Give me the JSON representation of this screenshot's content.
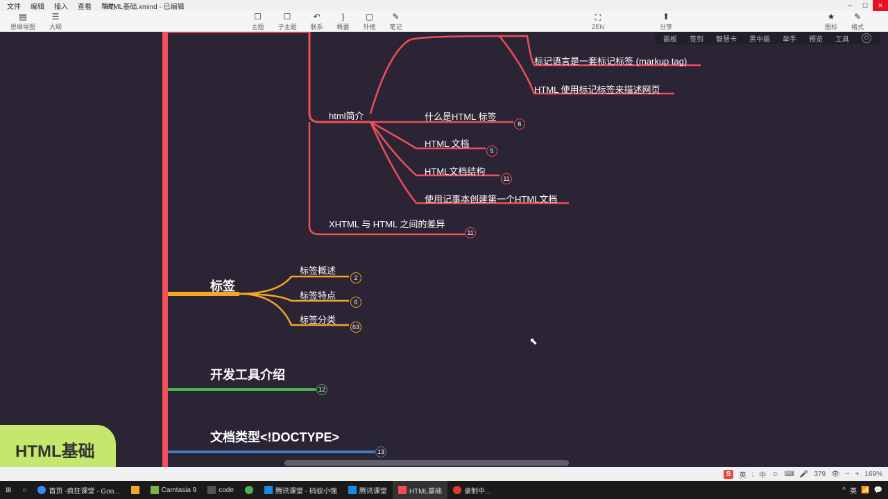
{
  "menu": {
    "file": "文件",
    "edit": "编辑",
    "insert": "插入",
    "view": "查看",
    "help": "帮助"
  },
  "title": "HTML基础.xmind - 已编辑",
  "toolbar": {
    "mindmap": "思维导图",
    "outline": "大纲",
    "theme": "主题",
    "layout": "子主题",
    "relation": "联系",
    "summary": "概要",
    "boundary": "外框",
    "notes": "笔记",
    "zen": "ZEN",
    "share": "分享",
    "iconlib": "图标",
    "format": "格式"
  },
  "darktabs": {
    "canvas": "画板",
    "sign": "签到",
    "smartcard": "智慧卡",
    "blackboard": "黑中画",
    "raise": "举手",
    "preview": "预览",
    "tools": "工具"
  },
  "root": "HTML基础",
  "nodes": {
    "branch1": "html简介",
    "b1c2": "什么是HTML 标签",
    "b1c3": "HTML 文档",
    "b1c4": "HTML文档结构",
    "b1c5": "使用记事本创建第一个HTML文档",
    "b1s1": "标记语言是一套标记标签 (markup tag)",
    "b1s2": "HTML 使用标记标签来描述网页",
    "branch1b": "XHTML 与 HTML 之间的差异",
    "branch2": "标签",
    "b2c1": "标签概述",
    "b2c2": "标签特点",
    "b2c3": "标签分类",
    "branch3": "开发工具介绍",
    "branch4": "文档类型<!DOCTYPE>"
  },
  "badges": {
    "b1c2": "6",
    "b1c3": "5",
    "b1c4": "11",
    "branch1b": "11",
    "b2c1": "2",
    "b2c2": "6",
    "b2c3": "63",
    "branch3": "12",
    "branch4": "13"
  },
  "status": {
    "ime": "S",
    "lang": "英",
    "punct": "中",
    "emoji": "☺",
    "count": "379",
    "sep": ";",
    "zoom": "169%"
  },
  "taskbar": {
    "t1": "首页 -疯狂课堂 - Goo...",
    "t2": "Camtasia 9",
    "t3": "code",
    "t4": "腾讯课堂 - 码蚁小强",
    "t5": "腾讯课堂",
    "t6": "HTML基础",
    "t7": "录制中..."
  }
}
